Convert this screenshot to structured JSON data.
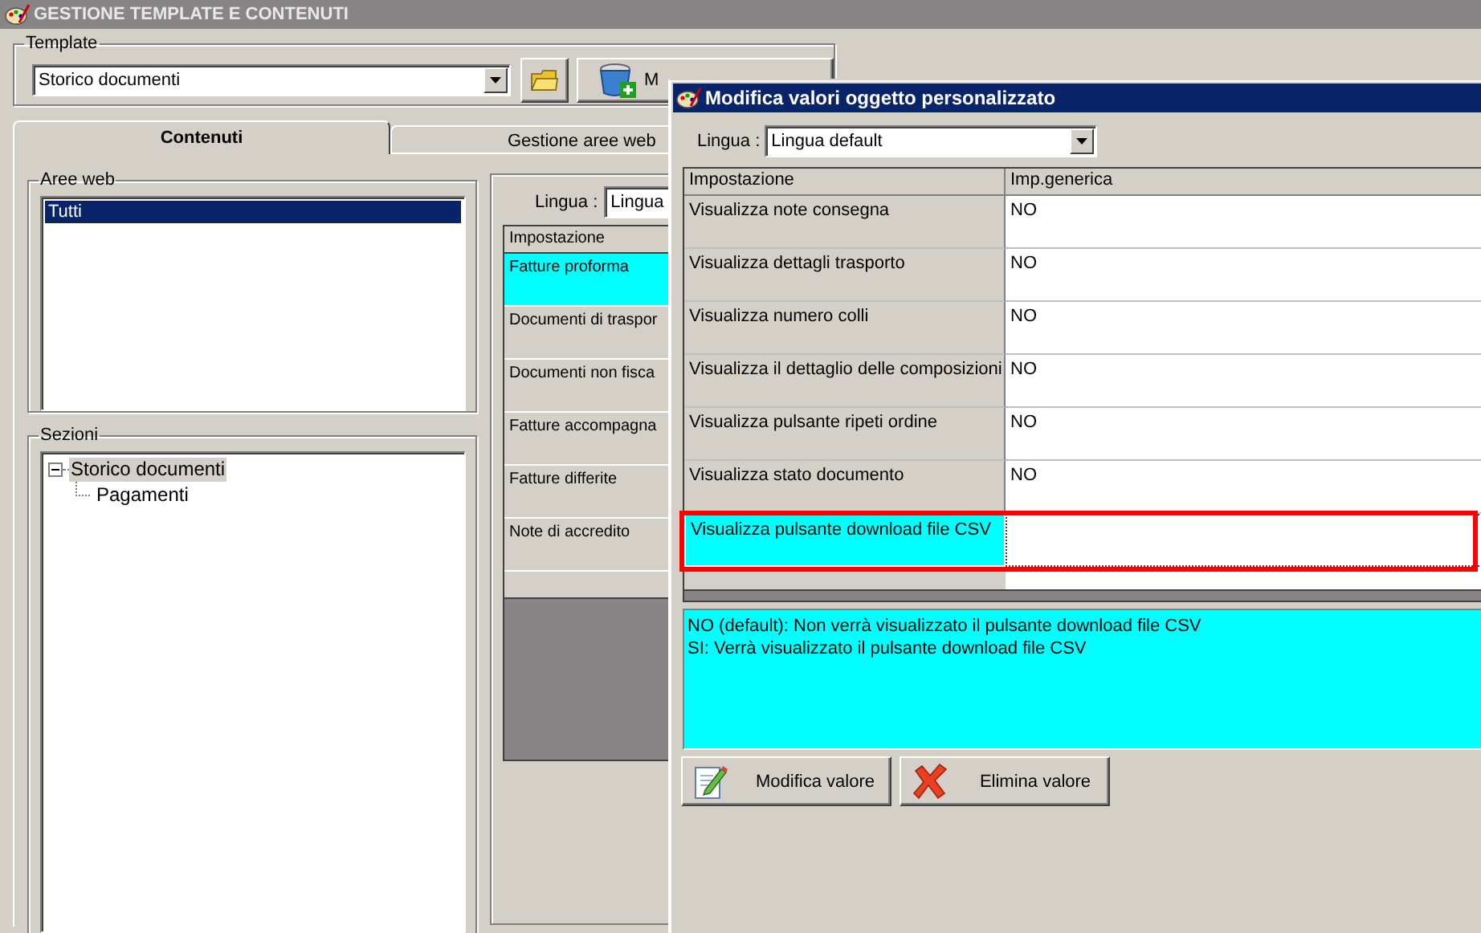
{
  "window": {
    "title": "GESTIONE TEMPLATE E CONTENUTI"
  },
  "template": {
    "label": "Template",
    "value": "Storico documenti",
    "new_button": "M"
  },
  "tabs": [
    {
      "label": "Contenuti",
      "selected": true
    },
    {
      "label": "Gestione aree web",
      "selected": false
    }
  ],
  "aree_web": {
    "label": "Aree web",
    "items": [
      {
        "label": "Tutti",
        "selected": true
      }
    ]
  },
  "sezioni": {
    "label": "Sezioni",
    "tree": [
      {
        "label": "Storico documenti",
        "expanded": true,
        "selected": true,
        "children": [
          {
            "label": "Pagamenti",
            "selected": false
          }
        ]
      }
    ]
  },
  "contents": {
    "lingua_label": "Lingua :",
    "lingua_value": "Lingua",
    "column": "Impostazione",
    "rows": [
      {
        "label": "Fatture proforma",
        "selected": true
      },
      {
        "label": "Documenti di traspor",
        "selected": false
      },
      {
        "label": "Documenti non fisca",
        "selected": false
      },
      {
        "label": "Fatture accompagna",
        "selected": false
      },
      {
        "label": "Fatture differite",
        "selected": false
      },
      {
        "label": "Note di accredito",
        "selected": false
      }
    ]
  },
  "dialog": {
    "title": "Modifica valori oggetto personalizzato",
    "lingua_label": "Lingua :",
    "lingua_value": "Lingua default",
    "columns": [
      "Impostazione",
      "Imp.generica"
    ],
    "rows": [
      {
        "label": "Visualizza note consegna",
        "value": "NO",
        "selected": false,
        "outlined": false
      },
      {
        "label": "Visualizza dettagli trasporto",
        "value": "NO",
        "selected": false,
        "outlined": false
      },
      {
        "label": "Visualizza numero colli",
        "value": "NO",
        "selected": false,
        "outlined": false
      },
      {
        "label": "Visualizza il dettaglio delle composizioni",
        "value": "NO",
        "selected": false,
        "outlined": false
      },
      {
        "label": "Visualizza pulsante ripeti ordine",
        "value": "NO",
        "selected": false,
        "outlined": false
      },
      {
        "label": "Visualizza stato documento",
        "value": "NO",
        "selected": false,
        "outlined": false
      },
      {
        "label": "Visualizza pulsante download file CSV",
        "selected": true,
        "outlined": true
      }
    ],
    "description": [
      "NO (default): Non verrà visualizzato il pulsante download file CSV",
      "SI: Verrà visualizzato il pulsante download file CSV"
    ],
    "buttons": [
      {
        "label": "Modifica valore",
        "kind": "edit"
      },
      {
        "label": "Elimina valore",
        "kind": "delete"
      }
    ]
  }
}
